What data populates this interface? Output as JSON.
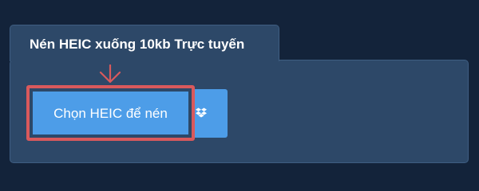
{
  "tab": {
    "title": "Nén HEIC xuống 10kb Trực tuyến"
  },
  "actions": {
    "choose_label": "Chọn HEIC để nén",
    "dropbox_icon": "dropbox-icon"
  },
  "colors": {
    "background": "#13233a",
    "panel": "#2d4868",
    "button": "#4d9de8",
    "highlight": "#d9595c"
  }
}
